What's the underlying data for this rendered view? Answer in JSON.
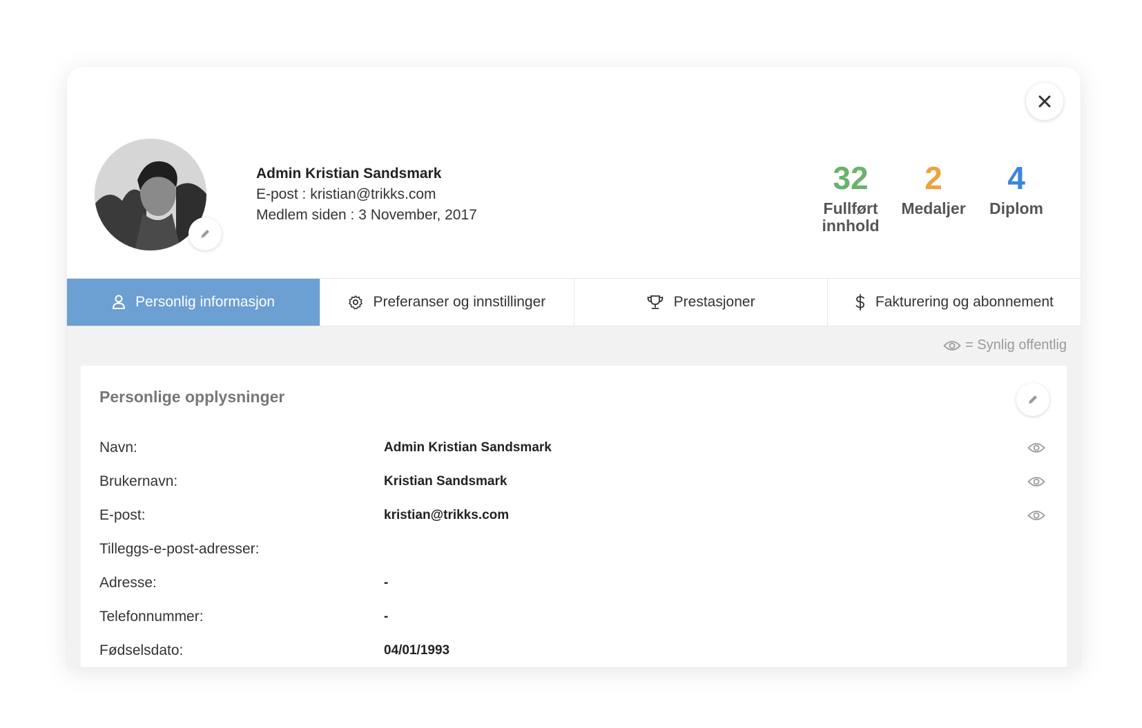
{
  "profile": {
    "name": "Admin Kristian Sandsmark",
    "email_line": "E-post : kristian@trikks.com",
    "member_since_line": "Medlem siden : 3 November, 2017"
  },
  "stats": [
    {
      "value": "32",
      "label": "Fullført innhold",
      "color": "#6bb26d"
    },
    {
      "value": "2",
      "label": "Medaljer",
      "color": "#eda23d"
    },
    {
      "value": "4",
      "label": "Diplom",
      "color": "#3b86df"
    }
  ],
  "tabs": [
    {
      "label": "Personlig informasjon",
      "icon": "user-icon",
      "active": true
    },
    {
      "label": "Preferanser og innstillinger",
      "icon": "gear-icon",
      "active": false
    },
    {
      "label": "Prestasjoner",
      "icon": "trophy-icon",
      "active": false
    },
    {
      "label": "Fakturering og abonnement",
      "icon": "dollar-icon",
      "active": false
    }
  ],
  "legend": {
    "text": "= Synlig offentlig",
    "icon": "eye-icon"
  },
  "panel": {
    "title": "Personlige opplysninger",
    "rows": [
      {
        "label": "Navn:",
        "value": "Admin Kristian Sandsmark",
        "public": true
      },
      {
        "label": "Brukernavn:",
        "value": "Kristian Sandsmark",
        "public": true
      },
      {
        "label": "E-post:",
        "value": "kristian@trikks.com",
        "public": true
      },
      {
        "label": "Tilleggs-e-post-adresser:",
        "value": "",
        "public": false
      },
      {
        "label": "Adresse:",
        "value": "-",
        "public": false
      },
      {
        "label": "Telefonnummer:",
        "value": "-",
        "public": false
      },
      {
        "label": "Fødselsdato:",
        "value": "04/01/1993",
        "public": false
      }
    ]
  },
  "colors": {
    "accent": "#6c9fd2",
    "background": "#f2f2f2"
  }
}
